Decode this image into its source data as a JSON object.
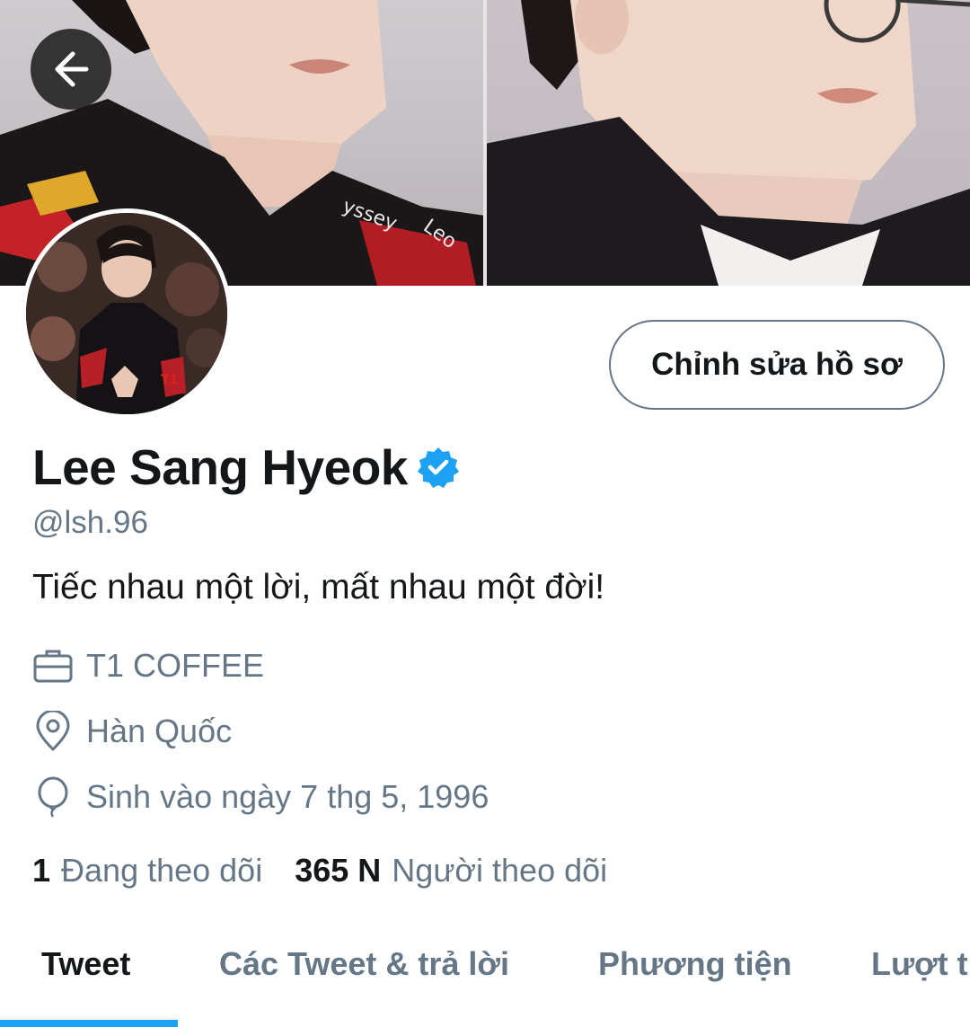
{
  "header": {
    "back_icon": "arrow-left-icon",
    "edit_profile_label": "Chỉnh sửa hồ sơ"
  },
  "profile": {
    "name": "Lee Sang Hyeok",
    "verified": true,
    "handle": "@lsh.96",
    "bio": "Tiếc nhau một lời, mất nhau một đời!",
    "work": "T1 COFFEE",
    "location": "Hàn Quốc",
    "birthday": "Sinh vào ngày 7 thg 5, 1996",
    "following_count": "1",
    "following_label": "Đang theo dõi",
    "followers_count": "365 N",
    "followers_label": "Người theo dõi"
  },
  "tabs": [
    {
      "label": "Tweet",
      "active": true
    },
    {
      "label": "Các Tweet & trả lời",
      "active": false
    },
    {
      "label": "Phương tiện",
      "active": false
    },
    {
      "label": "Lượt thích",
      "active": false
    }
  ],
  "colors": {
    "accent": "#1da1f2",
    "secondary_text": "#657786",
    "primary_text": "#14171a"
  }
}
